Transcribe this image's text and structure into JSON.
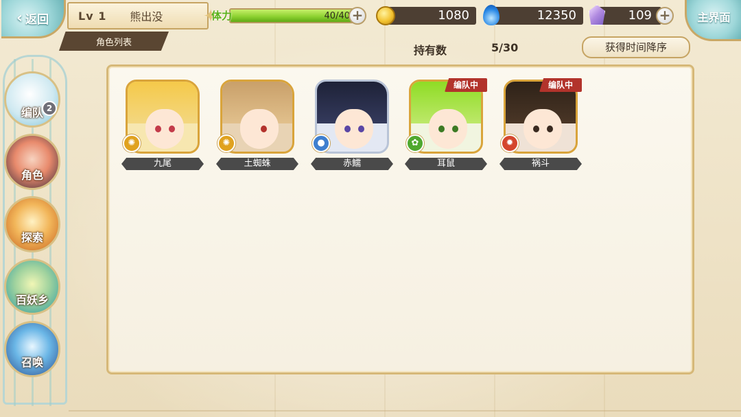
{
  "header": {
    "back_label": "返回",
    "level_label": "Lv 1",
    "player_name": "熊出没",
    "tab_title": "角色列表",
    "home_label": "主界面"
  },
  "stamina": {
    "label": "体力",
    "current": 40,
    "max": 40,
    "text": "40/40"
  },
  "currencies": {
    "gold": "1080",
    "souls": "12350",
    "gems": "109"
  },
  "collection": {
    "owned_label": "持有数",
    "owned_value": "5/30",
    "sort_label": "获得时间降序"
  },
  "sidebar": {
    "items": [
      {
        "label": "编队",
        "badge": "2"
      },
      {
        "label": "角色"
      },
      {
        "label": "探索"
      },
      {
        "label": "百妖乡"
      },
      {
        "label": "召唤"
      }
    ]
  },
  "characters": [
    {
      "name": "九尾",
      "in_team": false,
      "team_tag": ""
    },
    {
      "name": "土蜘蛛",
      "in_team": false,
      "team_tag": ""
    },
    {
      "name": "赤鱬",
      "in_team": false,
      "team_tag": ""
    },
    {
      "name": "耳鼠",
      "in_team": true,
      "team_tag": "编队中"
    },
    {
      "name": "祸斗",
      "in_team": true,
      "team_tag": "编队中"
    }
  ],
  "colors": {
    "accent_gold": "#d6b878",
    "team_tag_red": "#b2332b",
    "stamina_green": "#8ed232"
  }
}
